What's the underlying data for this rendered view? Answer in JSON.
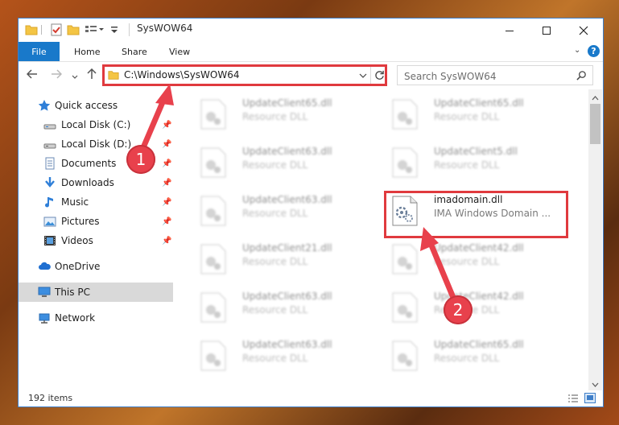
{
  "window": {
    "title": "SysWOW64"
  },
  "ribbon": {
    "file_label": "File",
    "tabs": [
      "Home",
      "Share",
      "View"
    ],
    "help_label": "?"
  },
  "nav": {
    "address": "C:\\Windows\\SysWOW64",
    "search_placeholder": "Search SysWOW64"
  },
  "sidebar": {
    "quick_access": "Quick access",
    "items": [
      {
        "label": "Local Disk (C:)",
        "icon": "drive-icon"
      },
      {
        "label": "Local Disk (D:)",
        "icon": "drive-icon"
      },
      {
        "label": "Documents",
        "icon": "documents-icon"
      },
      {
        "label": "Downloads",
        "icon": "downloads-icon"
      },
      {
        "label": "Music",
        "icon": "music-icon"
      },
      {
        "label": "Pictures",
        "icon": "pictures-icon"
      },
      {
        "label": "Videos",
        "icon": "videos-icon"
      }
    ],
    "onedrive": "OneDrive",
    "thispc": "This PC",
    "network": "Network"
  },
  "files": {
    "left": [
      {
        "name": "UpdateClient65.dll",
        "type": "Resource DLL"
      },
      {
        "name": "UpdateClient63.dll",
        "type": "Resource DLL"
      },
      {
        "name": "UpdateClient63.dll",
        "type": "Resource DLL"
      },
      {
        "name": "UpdateClient21.dll",
        "type": "Resource DLL"
      },
      {
        "name": "UpdateClient63.dll",
        "type": "Resource DLL"
      },
      {
        "name": "UpdateClient63.dll",
        "type": "Resource DLL"
      }
    ],
    "right": [
      {
        "name": "UpdateClient65.dll",
        "type": "Resource DLL"
      },
      {
        "name": "UpdateClient5.dll",
        "type": "Resource DLL"
      },
      {
        "name": "imadomain.dll",
        "type": "IMA Windows Domain ..."
      },
      {
        "name": "UpdateClient42.dll",
        "type": "Resource DLL"
      },
      {
        "name": "UpdateClient42.dll",
        "type": "Resource DLL"
      },
      {
        "name": "UpdateClient65.dll",
        "type": "Resource DLL"
      }
    ]
  },
  "status": {
    "count": "192 items"
  },
  "callouts": {
    "one": "1",
    "two": "2"
  },
  "colors": {
    "accent": "#1979ca",
    "highlight": "#e03a3e"
  }
}
